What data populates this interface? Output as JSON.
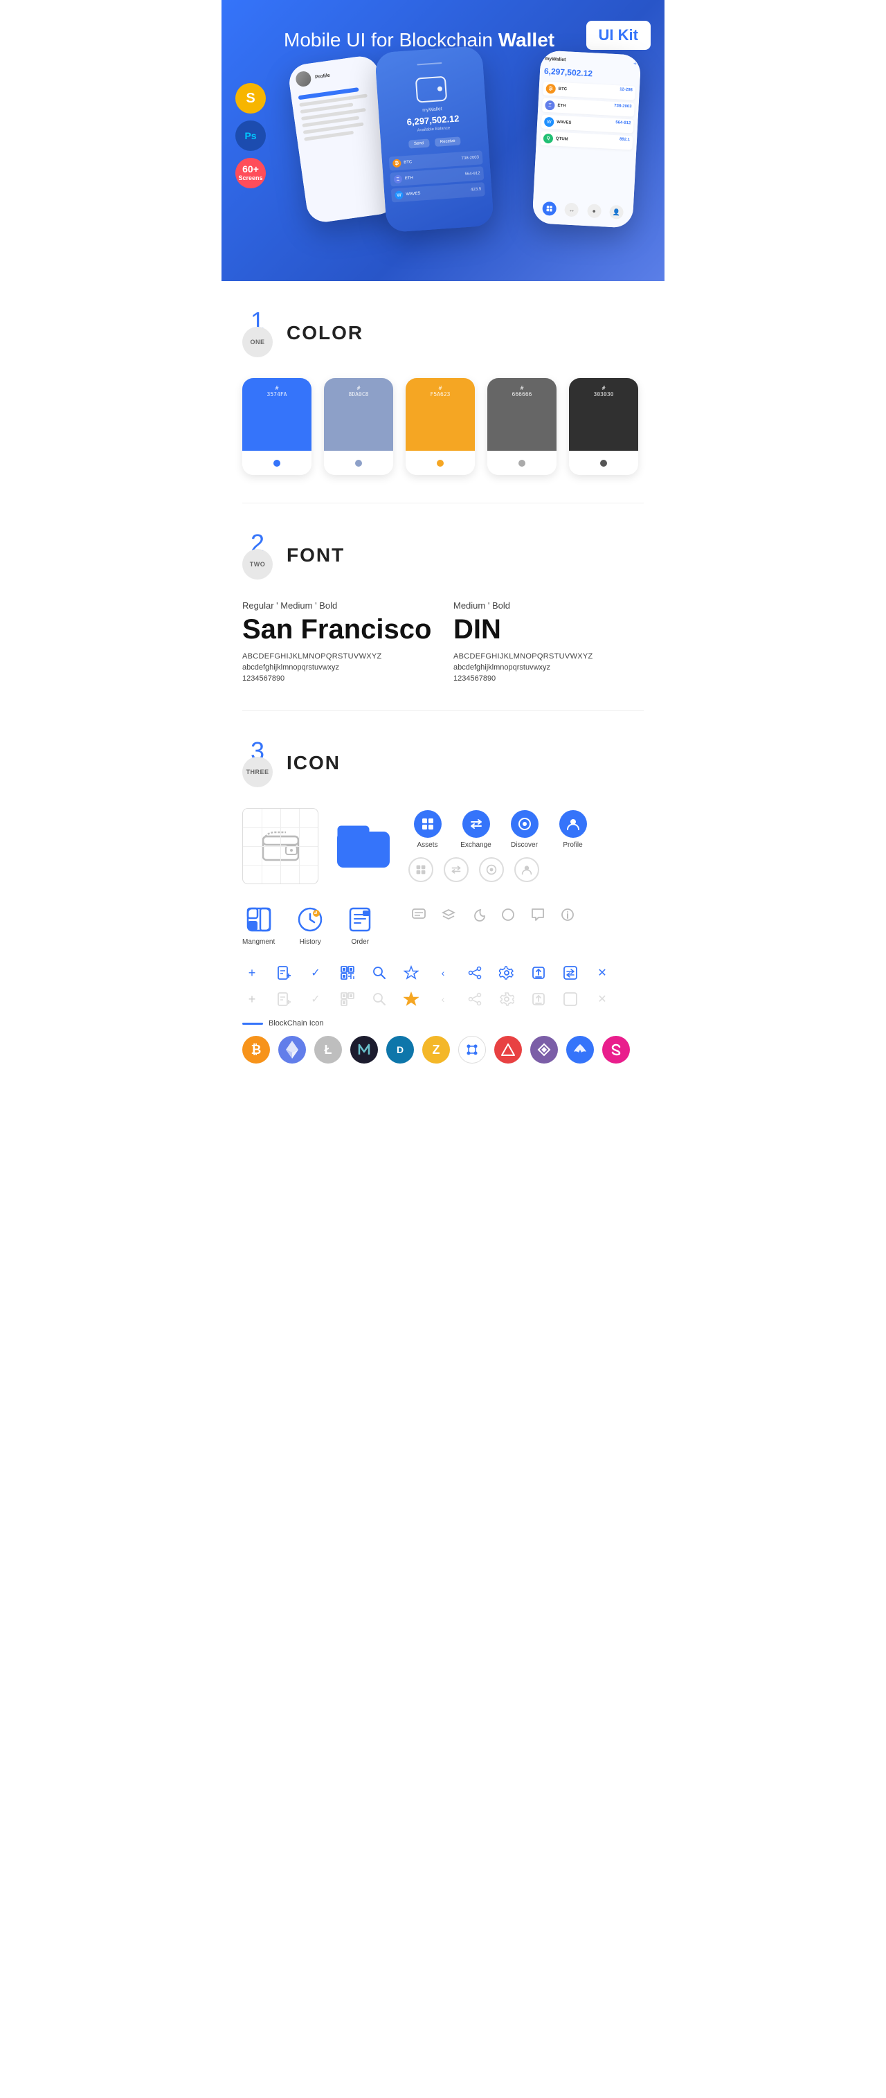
{
  "hero": {
    "title_regular": "Mobile UI for Blockchain ",
    "title_bold": "Wallet",
    "badge": "UI Kit",
    "badges": [
      {
        "id": "sketch",
        "label": "S",
        "bg": "#F7B500"
      },
      {
        "id": "ps",
        "label": "Ps",
        "bg": "#00C8FF"
      },
      {
        "id": "screens",
        "count": "60+",
        "text": "Screens",
        "bg": "#FF4D5A"
      }
    ],
    "phone_center_amount": "6,297,502.12",
    "phone_center_label": "myWallet"
  },
  "section1": {
    "number": "1",
    "number_word": "ONE",
    "title": "COLOR",
    "swatches": [
      {
        "hex": "#3574FA",
        "code": "#\n3574FA",
        "dot_color": "#fff"
      },
      {
        "hex": "#8DA0C8",
        "code": "#\n8DA0C8",
        "dot_color": "#fff"
      },
      {
        "hex": "#F5A623",
        "code": "#\nF5A623",
        "dot_color": "#fff"
      },
      {
        "hex": "#666666",
        "code": "#\n666666",
        "dot_color": "#888"
      },
      {
        "hex": "#303030",
        "code": "#\n303030",
        "dot_color": "#555"
      }
    ]
  },
  "section2": {
    "number": "2",
    "number_word": "TWO",
    "title": "FONT",
    "fonts": [
      {
        "style_label": "Regular ' Medium ' Bold",
        "name": "San Francisco",
        "uppercase": "ABCDEFGHIJKLMNOPQRSTUVWXYZ",
        "lowercase": "abcdefghijklmnopqrstuvwxyz",
        "numbers": "1234567890"
      },
      {
        "style_label": "Medium ' Bold",
        "name": "DIN",
        "uppercase": "ABCDEFGHIJKLMNOPQRSTUVWXYZ",
        "lowercase": "abcdefghijklmnopqrstuvwxyz",
        "numbers": "1234567890"
      }
    ]
  },
  "section3": {
    "number": "3",
    "number_word": "THREE",
    "title": "ICON",
    "nav_icons": [
      {
        "label": "Assets",
        "color": "#3574FA"
      },
      {
        "label": "Exchange",
        "color": "#3574FA"
      },
      {
        "label": "Discover",
        "color": "#3574FA"
      },
      {
        "label": "Profile",
        "color": "#3574FA"
      }
    ],
    "bottom_icons": [
      {
        "label": "Mangment"
      },
      {
        "label": "History"
      },
      {
        "label": "Order"
      }
    ],
    "blockchain_label": "BlockChain Icon",
    "crypto_icons": [
      {
        "symbol": "₿",
        "bg": "#F7931A",
        "color": "#fff",
        "name": "Bitcoin"
      },
      {
        "symbol": "Ξ",
        "bg": "#627EEA",
        "color": "#fff",
        "name": "Ethereum"
      },
      {
        "symbol": "Ł",
        "bg": "#BFBBBB",
        "color": "#fff",
        "name": "Litecoin"
      },
      {
        "symbol": "◈",
        "bg": "#1B1F2A",
        "color": "#69C0CA",
        "name": "NEO"
      },
      {
        "symbol": "D",
        "bg": "#0E76AA",
        "color": "#fff",
        "name": "Dash"
      },
      {
        "symbol": "Z",
        "bg": "#F4B728",
        "color": "#fff",
        "name": "Zcash"
      },
      {
        "symbol": "◎",
        "bg": "#fff",
        "color": "#3574FA",
        "border": "#ddd",
        "name": "IOTA"
      },
      {
        "symbol": "▲",
        "bg": "#E84142",
        "color": "#fff",
        "name": "Avax"
      },
      {
        "symbol": "◆",
        "bg": "#7B5EA7",
        "color": "#fff",
        "name": "Kyber"
      },
      {
        "symbol": "~",
        "bg": "#3574FA",
        "color": "#fff",
        "name": "BAT"
      },
      {
        "symbol": "∞",
        "bg": "#E91E8C",
        "color": "#fff",
        "name": "Streamr"
      }
    ]
  }
}
